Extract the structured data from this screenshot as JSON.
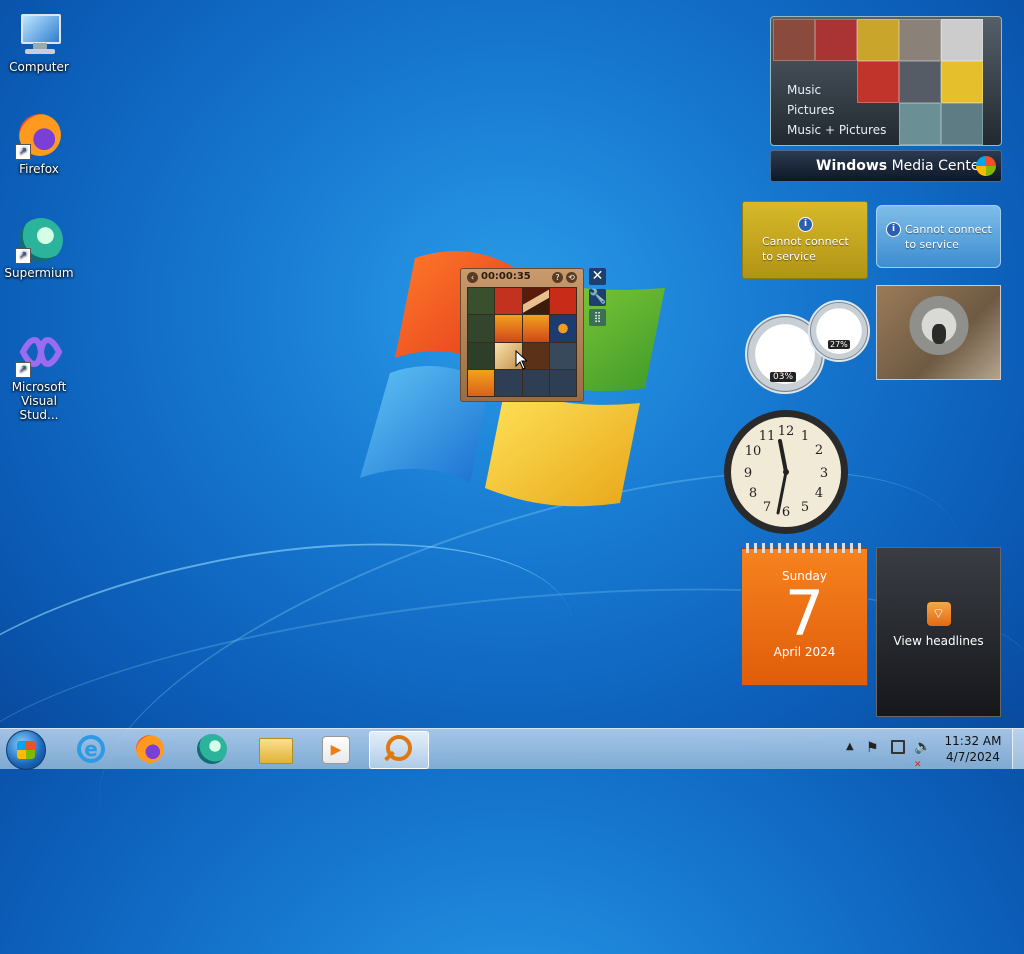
{
  "desktop": {
    "icons": [
      {
        "label": "Computer"
      },
      {
        "label": "Firefox"
      },
      {
        "label": "Supermium"
      },
      {
        "label_line1": "Microsoft",
        "label_line2": "Visual Stud..."
      }
    ]
  },
  "gadgets": {
    "media_center": {
      "menu": [
        "Music",
        "Pictures",
        "Music + Pictures"
      ],
      "brand_bold": "Windows",
      "brand_rest": " Media Center"
    },
    "weather": {
      "message_line1": "Cannot connect",
      "message_line2": "to service"
    },
    "currency": {
      "message_line1": "Cannot connect",
      "message_line2": "to service"
    },
    "cpu_meter": {
      "cpu": "03%",
      "memory": "27%"
    },
    "calendar": {
      "weekday": "Sunday",
      "day": "7",
      "month_year": "April 2024"
    },
    "feed": {
      "label": "View headlines"
    },
    "puzzle": {
      "timer": "00:00:35"
    }
  },
  "taskbar": {
    "time": "11:32 AM",
    "date": "4/7/2024"
  }
}
